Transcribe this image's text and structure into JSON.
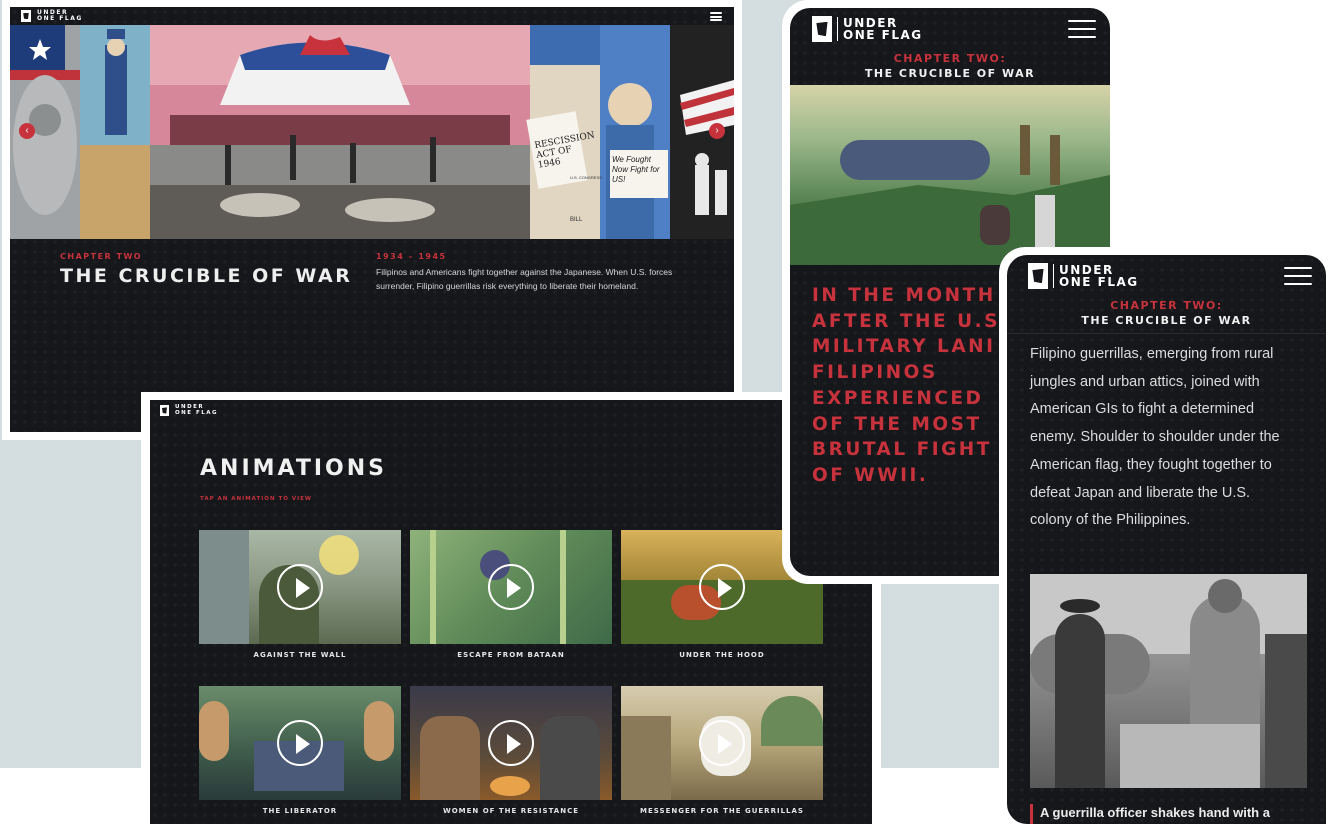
{
  "brand": {
    "line1": "UNDER",
    "line2": "ONE FLAG"
  },
  "desktop": {
    "chapter_label": "CHAPTER TWO",
    "title": "THE CRUCIBLE OF WAR",
    "years": "1934 – 1945",
    "description": "Filipinos and Americans fight together against the Japanese. When U.S. forces surrender, Filipino guerrillas risk everything to liberate their homeland.",
    "sign_text_1": "RESCISSION ACT OF 1946",
    "sign_text_2": "We Fought Now Fight for US!",
    "sign_text_3": "U.S. CONGRESS",
    "sign_text_4": "BILL"
  },
  "animations": {
    "title": "ANIMATIONS",
    "subtitle": "TAP AN ANIMATION TO VIEW",
    "items": [
      {
        "label": "AGAINST THE WALL"
      },
      {
        "label": "ESCAPE FROM BATAAN"
      },
      {
        "label": "UNDER THE HOOD"
      },
      {
        "label": "THE LIBERATOR"
      },
      {
        "label": "WOMEN OF THE RESISTANCE"
      },
      {
        "label": "MESSENGER FOR THE GUERRILLAS"
      }
    ]
  },
  "mobile1": {
    "chapter_label": "CHAPTER TWO:",
    "title": "THE CRUCIBLE OF WAR",
    "quote_lines": [
      "IN THE MONTH",
      "AFTER THE U.S",
      "MILITARY LANI",
      "FILIPINOS",
      "EXPERIENCED",
      "OF THE MOST",
      "BRUTAL FIGHT",
      "OF WWII."
    ]
  },
  "mobile2": {
    "chapter_label": "CHAPTER TWO:",
    "title": "THE CRUCIBLE OF WAR",
    "body_lines": [
      "Filipino guerrillas, emerging from rural",
      "jungles and urban attics, joined with",
      "American GIs to fight a determined",
      "enemy. Shoulder to shoulder under the",
      "American flag, they fought together to",
      "defeat Japan and liberate the U.S.",
      "colony of the Philippines."
    ],
    "photo_caption": "A guerrilla officer shakes hand with a"
  },
  "colors": {
    "accent_red": "#c8323c",
    "dark_bg": "#15171b",
    "backdrop": "#d4dde0"
  }
}
